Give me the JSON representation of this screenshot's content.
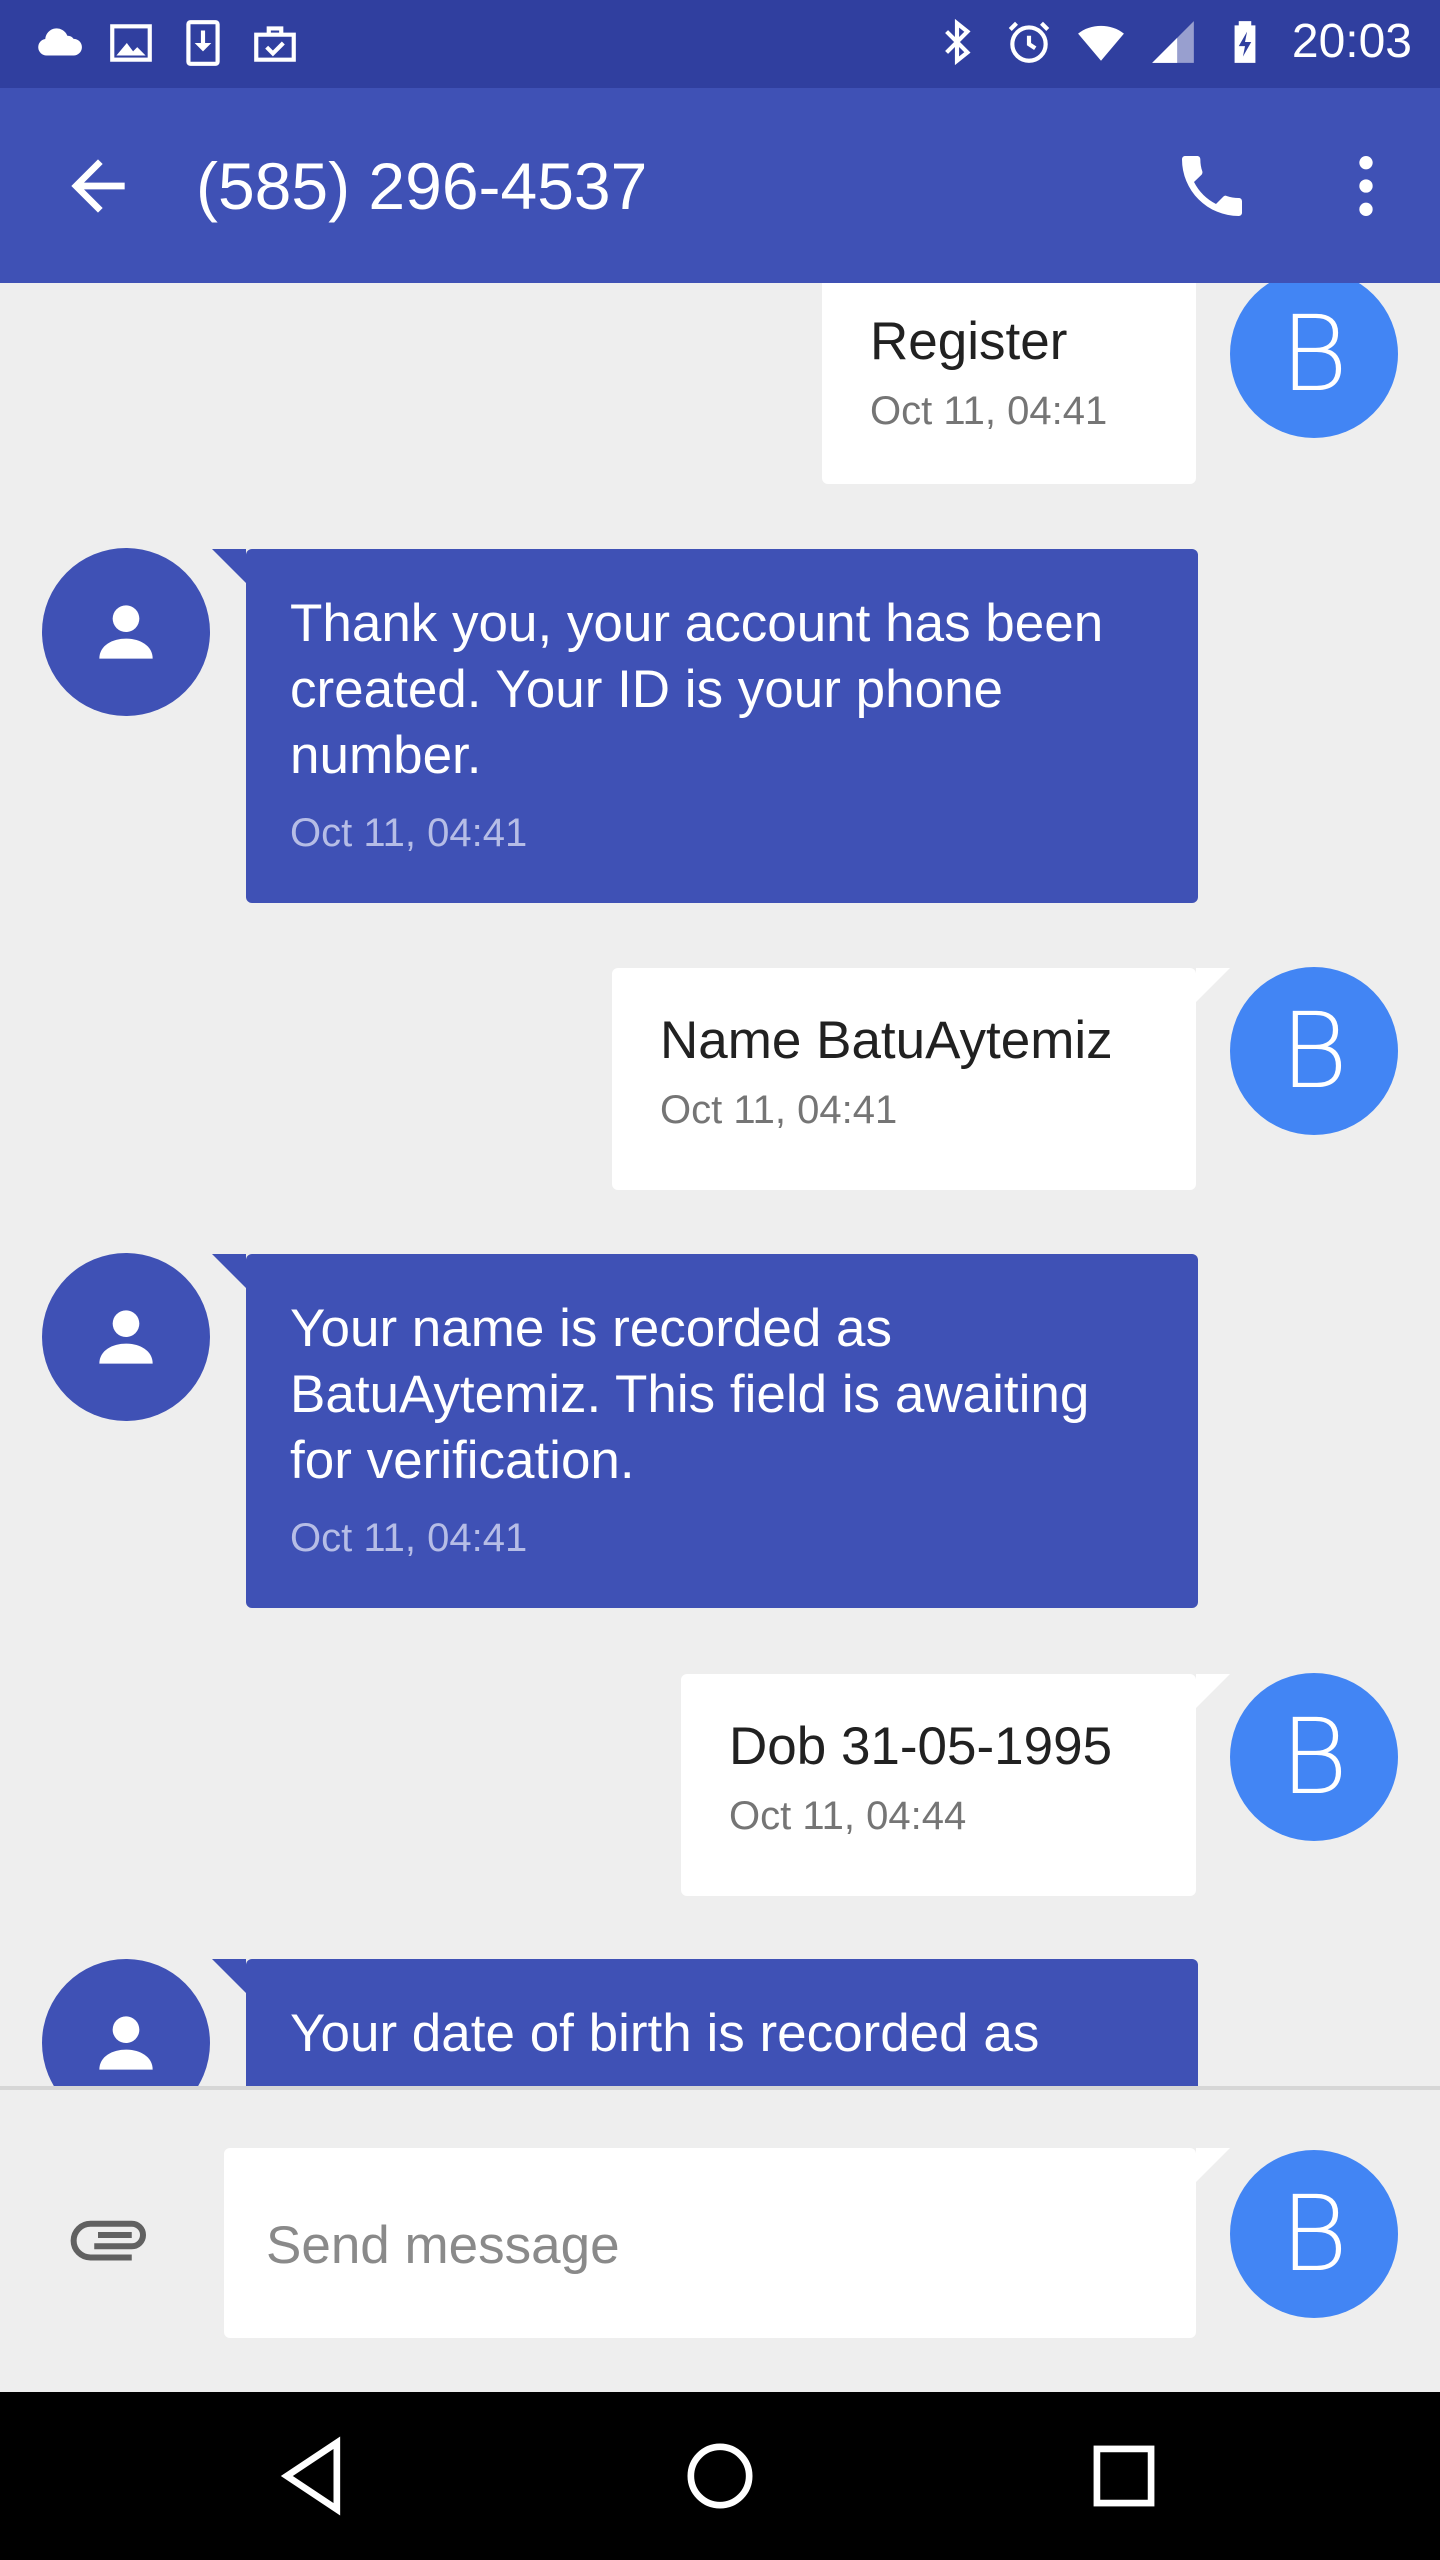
{
  "status_bar": {
    "time": "20:03",
    "left_icons": [
      "cloud-icon",
      "image-icon",
      "download-icon",
      "briefcase-check-icon"
    ],
    "right_icons": [
      "bluetooth-icon",
      "alarm-icon",
      "wifi-icon",
      "signal-icon",
      "battery-charging-icon"
    ]
  },
  "app_bar": {
    "title": "(585) 296-4537",
    "icons": [
      "back-arrow-icon",
      "phone-icon",
      "more-vert-icon"
    ]
  },
  "messages": [
    {
      "direction": "outgoing",
      "text": "Register",
      "time": "Oct 11, 04:41",
      "avatar": "B"
    },
    {
      "direction": "incoming",
      "text": "Thank you, your account has been created. Your ID is your phone number.",
      "time": "Oct 11, 04:41",
      "avatar": "person-icon"
    },
    {
      "direction": "outgoing",
      "text": "Name BatuAytemiz",
      "time": "Oct 11, 04:41",
      "avatar": "B"
    },
    {
      "direction": "incoming",
      "text": "Your name is recorded as BatuAytemiz. This field is awaiting for verification.",
      "time": "Oct 11, 04:41",
      "avatar": "person-icon"
    },
    {
      "direction": "outgoing",
      "text": "Dob 31-05-1995",
      "time": "Oct 11, 04:44",
      "avatar": "B"
    },
    {
      "direction": "incoming",
      "text": "Your date of birth is recorded as",
      "time": "",
      "avatar": "person-icon"
    }
  ],
  "compose": {
    "placeholder": "Send message",
    "value": "",
    "avatar": "B",
    "attach_icon": "paperclip-icon"
  },
  "nav_bar": {
    "icons": [
      "nav-back-icon",
      "nav-home-icon",
      "nav-recents-icon"
    ]
  },
  "colors": {
    "status_bar": "#303f9f",
    "app_bar": "#3f51b5",
    "incoming_bubble": "#3f51b5",
    "outgoing_bubble": "#ffffff",
    "avatar_b": "#4285f4",
    "background": "#eeeeee"
  }
}
